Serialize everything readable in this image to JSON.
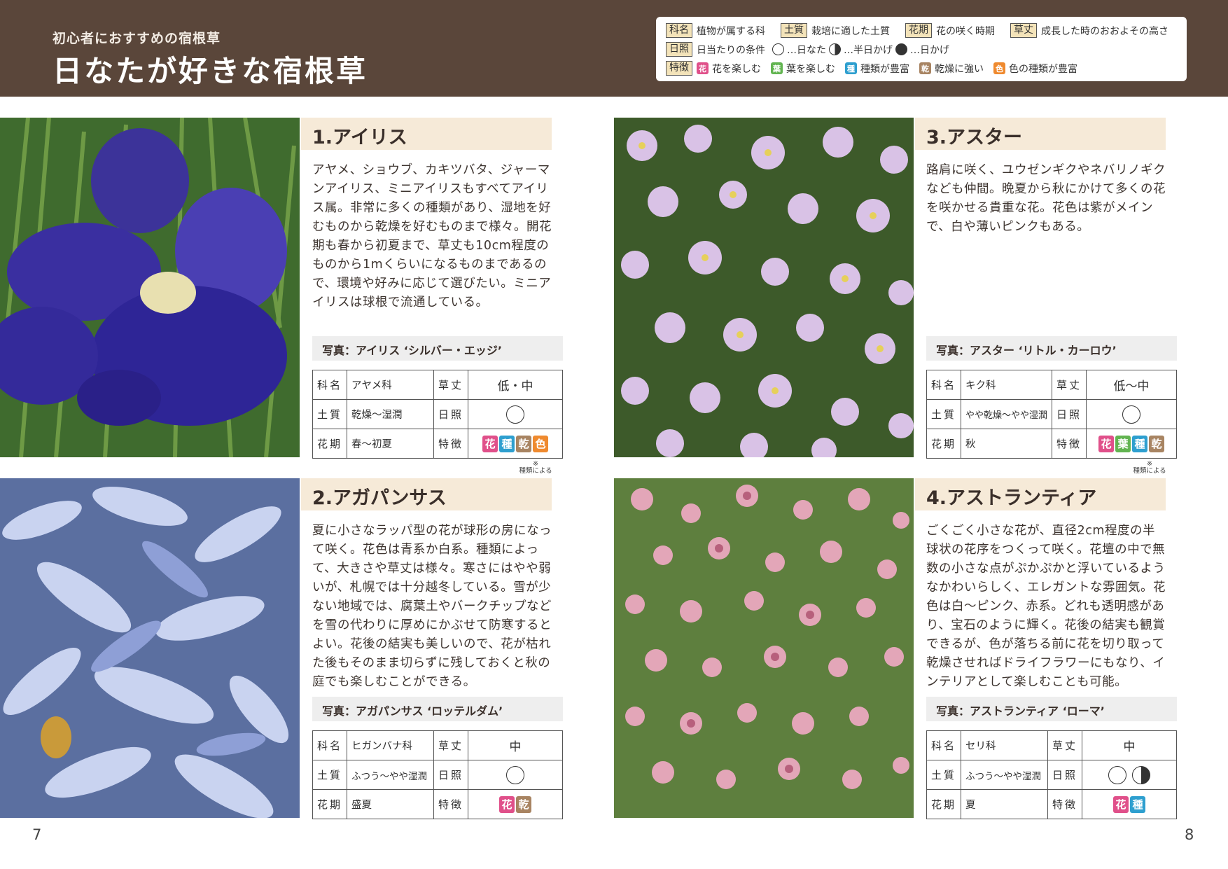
{
  "header": {
    "kicker": "初心者におすすめの宿根草",
    "title": "日なたが好きな宿根草"
  },
  "legend": {
    "items": [
      {
        "key": "科名",
        "text": "植物が属する科"
      },
      {
        "key": "土質",
        "text": "栽培に適した土質"
      },
      {
        "key": "花期",
        "text": "花の咲く時期"
      },
      {
        "key": "草丈",
        "text": "成長した時のおおよその高さ"
      }
    ],
    "sun_key": "日照",
    "sun_label": "日当たりの条件",
    "sun_full": "…日なた",
    "sun_half": "…半日かげ",
    "sun_shade": "…日かげ",
    "feature_key": "特徴",
    "features": [
      {
        "chip": "花",
        "text": "花を楽しむ",
        "color": "#e0508a"
      },
      {
        "chip": "葉",
        "text": "葉を楽しむ",
        "color": "#62b451"
      },
      {
        "chip": "種",
        "text": "種類が豊富",
        "color": "#2e9fcf"
      },
      {
        "chip": "乾",
        "text": "乾燥に強い",
        "color": "#a88462"
      },
      {
        "chip": "色",
        "text": "色の種類が豊富",
        "color": "#ef8a2f"
      }
    ]
  },
  "spec_labels": {
    "family": "科名",
    "height": "草丈",
    "soil": "土質",
    "sun": "日照",
    "bloom": "花期",
    "feature": "特徴"
  },
  "plants": [
    {
      "title": "1.アイリス",
      "desc": "アヤメ、ショウブ、カキツバタ、ジャーマンアイリス、ミニアイリスもすべてアイリス属。非常に多くの種類があり、湿地を好むものから乾燥を好むものまで様々。開花期も春から初夏まで、草丈も10cm程度のものから1mくらいになるものまであるので、環境や好みに応じて選びたい。ミニアイリスは球根で流通している。",
      "caption": "写真：アイリス ‘シルバー・エッジ’",
      "family": "アヤメ科",
      "height": "低・中",
      "soil": "乾燥〜湿潤",
      "bloom": "春〜初夏",
      "sun": [
        "full"
      ],
      "features": [
        "花",
        "種",
        "乾",
        "色"
      ],
      "note_mark": "※",
      "note": "種類による"
    },
    {
      "title": "2.アガパンサス",
      "desc": "夏に小さなラッパ型の花が球形の房になって咲く。花色は青系か白系。種類によって、大きさや草丈は様々。寒さにはやや弱いが、札幌では十分越冬している。雪が少ない地域では、腐葉土やバークチップなどを雪の代わりに厚めにかぶせて防寒するとよい。花後の結実も美しいので、花が枯れた後もそのまま切らずに残しておくと秋の庭でも楽しむことができる。",
      "caption": "写真：アガパンサス ‘ロッテルダム’",
      "family": "ヒガンバナ科",
      "height": "中",
      "soil": "ふつう〜やや湿潤",
      "bloom": "盛夏",
      "sun": [
        "full"
      ],
      "features": [
        "花",
        "乾"
      ]
    },
    {
      "title": "3.アスター",
      "desc": "路肩に咲く、ユウゼンギクやネバリノギクなども仲間。晩夏から秋にかけて多くの花を咲かせる貴重な花。花色は紫がメインで、白や薄いピンクもある。",
      "caption": "写真：アスター ‘リトル・カーロウ’",
      "family": "キク科",
      "height": "低〜中",
      "soil": "やや乾燥〜やや湿潤",
      "bloom": "秋",
      "sun": [
        "full"
      ],
      "features": [
        "花",
        "葉",
        "種",
        "乾"
      ],
      "note_mark": "※",
      "note": "種類による"
    },
    {
      "title": "4.アストランティア",
      "desc": "ごくごく小さな花が、直径2cm程度の半球状の花序をつくって咲く。花壇の中で無数の小さな点がぷかぷかと浮いているようなかわいらしく、エレガントな雰囲気。花色は白〜ピンク、赤系。どれも透明感があり、宝石のように輝く。花後の結実も観賞できるが、色が落ちる前に花を切り取って乾燥させればドライフラワーにもなり、インテリアとして楽しむことも可能。",
      "caption": "写真：アストランティア ‘ローマ’",
      "family": "セリ科",
      "height": "中",
      "soil": "ふつう〜やや湿潤",
      "bloom": "夏",
      "sun": [
        "full",
        "half"
      ],
      "features": [
        "花",
        "種"
      ]
    }
  ],
  "page_numbers": {
    "left": "7",
    "right": "8"
  }
}
